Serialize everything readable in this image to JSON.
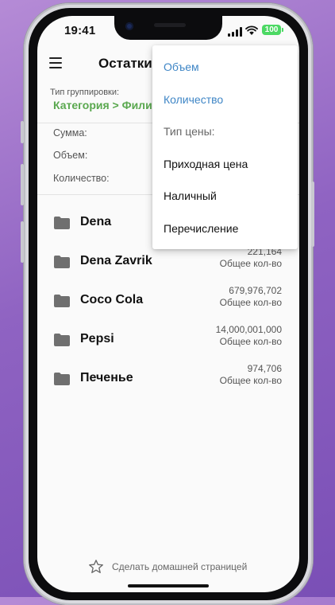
{
  "status_bar": {
    "time": "19:41",
    "battery": "100"
  },
  "app_bar": {
    "title": "Остатки"
  },
  "grouping": {
    "label": "Тип группировки:",
    "value": "Категория > Филиал"
  },
  "summary": {
    "sum_label": "Сумма:",
    "volume_label": "Объем:",
    "quantity_label": "Количество:"
  },
  "items": [
    {
      "name": "Dena",
      "value": "",
      "sub": ""
    },
    {
      "name": "Dena Zavrik",
      "value": "221,164",
      "sub": "Общее кол-во"
    },
    {
      "name": "Coco Cola",
      "value": "679,976,702",
      "sub": "Общее кол-во"
    },
    {
      "name": "Pepsi",
      "value": "14,000,001,000",
      "sub": "Общее кол-во"
    },
    {
      "name": "Печенье",
      "value": "974,706",
      "sub": "Общее кол-во"
    }
  ],
  "dropdown": {
    "items": [
      {
        "label": "Объем",
        "style": "blue"
      },
      {
        "label": "Количество",
        "style": "blue"
      },
      {
        "label": "Тип цены:",
        "style": "header"
      },
      {
        "label": "Приходная цена",
        "style": "normal"
      },
      {
        "label": "Наличный",
        "style": "normal"
      },
      {
        "label": "Перечисление",
        "style": "normal"
      }
    ]
  },
  "footer": {
    "label": "Сделать домашней страницей"
  },
  "colors": {
    "accent_green": "#5aa84f",
    "accent_blue": "#3f86c6",
    "background_purple": "#8f63c2"
  },
  "icons": {
    "menu": "hamburger-icon",
    "folder": "folder-icon",
    "star": "star-outline-icon",
    "wifi": "wifi-icon",
    "signal": "signal-bars-icon"
  }
}
